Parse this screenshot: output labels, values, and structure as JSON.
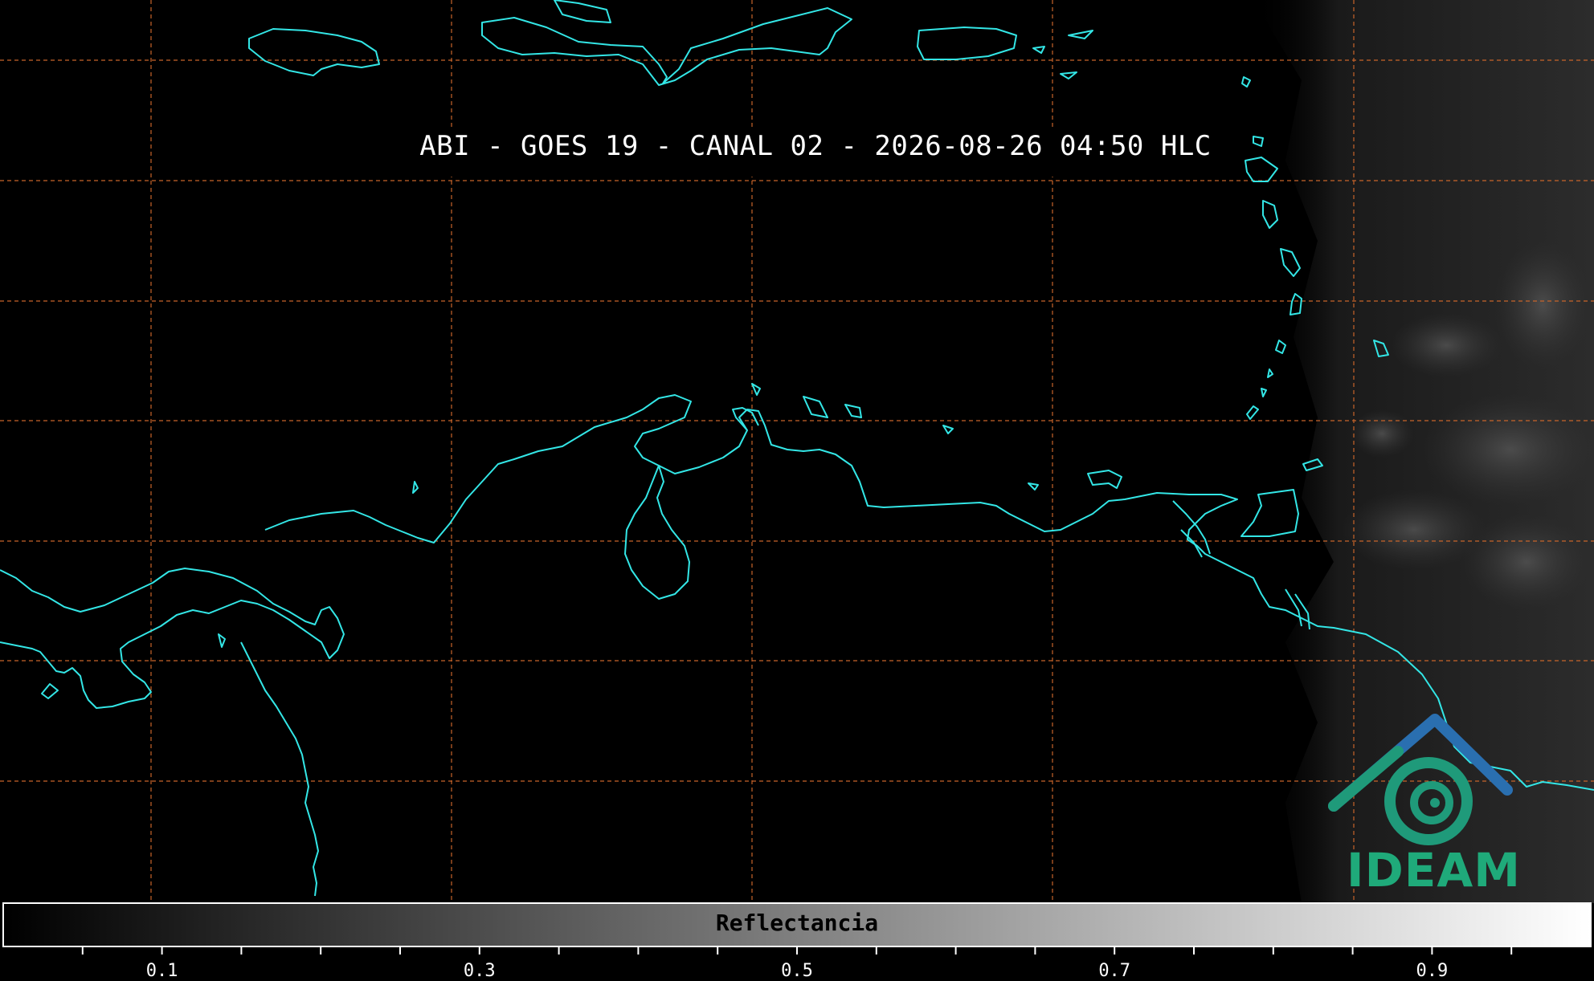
{
  "title": "ABI - GOES 19 - CANAL 02 - 2026-08-26 04:50 HLC",
  "logo": {
    "text": "IDEAM",
    "color": "#1faa7a",
    "accent": "#2a6fb0"
  },
  "colorbar": {
    "label": "Reflectancia",
    "range": [
      0,
      1
    ],
    "tick_labels": [
      "0.1",
      "0.3",
      "0.5",
      "0.7",
      "0.9"
    ],
    "tick_values": [
      0.1,
      0.3,
      0.5,
      0.7,
      0.9
    ],
    "minor_tick_step": 0.05
  },
  "map": {
    "background": "#000000",
    "coastline_color": "#33e6e6",
    "gridline_color": "#c8642a",
    "gridline_style": "dashed"
  }
}
